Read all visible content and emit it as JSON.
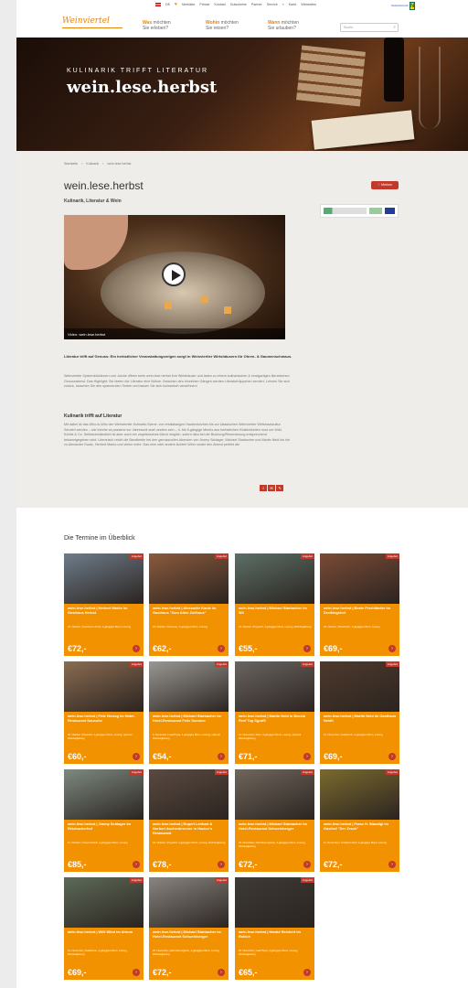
{
  "topbar": {
    "lang": "DE",
    "links": [
      "Merkliste",
      "Presse",
      "Kontakt",
      "Gutscheine",
      "Partner",
      "Service",
      "Karte",
      "Webseiten"
    ],
    "partner_logo": "Niederösterreich"
  },
  "nav": {
    "logo": "Weinviertel",
    "items": [
      {
        "hl": "Was",
        "rest": "möchten",
        "line2": "Sie erleben?"
      },
      {
        "hl": "Wohin",
        "rest": "möchten",
        "line2": "Sie reisen?"
      },
      {
        "hl": "Wann",
        "rest": "möchten",
        "line2": "Sie urlauben?"
      }
    ],
    "search_placeholder": "Suche"
  },
  "hero": {
    "kicker": "KULINARIK TRIFFT LITERATUR",
    "title": "wein.lese.herbst"
  },
  "breadcrumb": [
    "Startseite",
    "Kulinarik",
    "wein.lese.herbst"
  ],
  "page": {
    "title": "wein.lese.herbst",
    "subtitle": "Kulinarik, Literatur & Wein",
    "merken": "Merken",
    "video_caption": "Video: wein.lese.herbst",
    "lead": "Literatur trifft auf Genuss: Ein herbstlicher Veranstaltungsreigen sorgt in Weinviertler Wirtshäusern für Ohren- & Gaumenschmaus.",
    "para1": "Weinviertler Spitzenköchinnen und -köche öffnen beim wein.lese.herbst ihre Wirtshäuser und laden zu einem kulinarischen & einzigartigen literarischen Genussabend. Das Highlight: Sie bieten der Literatur eine Bühne. Zwischen den einzelnen Gängen werden Literaturhäppchen serviert. Lehnen Sie sich zurück, lauschen Sie den spannenden Texten und lassen Sie sich kulinarisch verwöhnen!",
    "h3": "Kulinarik trifft auf Literatur",
    "para2": "Mit dabei ist das Who-is-Who der Weinviertler Kulinarik-Szene, von erstklassigen Haubenköchen bis zur klassischen Weinviertler Wirtshauskultur. Serviert werden – wie könnte es passend zur Jahreszeit auch anders sein – 4- bis 5-gängige Menüs aus herbstlichen Köstlichkeiten rund um Wild, Kürbis & Co. Selbstverständlich ist aber auch ein vegetarisches Menü möglich, sofern dies bei der Buchung/Reservierung entsprechend bekanntgegeben wird. Literarisch reicht die Bandbreite bei den genussvollen Abenden von Jimmy Schlager, Michael Starbacher und Martin Neid bis hin zu Alexander Kautz, Herbert Marko und vielen mehr. Das eine oder andere Achterl Wein rundet den Abend perfekt ab!",
    "share": [
      "f",
      "✉",
      "✎"
    ]
  },
  "events": {
    "heading": "Die Termine im Überblick",
    "badge": "Angebot",
    "cards": [
      {
        "title": "wein.lese.herbst | Herbert Marko im Gasthaus Herbst",
        "meta": "22. Oktober | Gasthaus Herbst, 4-gängiges Menü, Lesung",
        "price": "€72,-",
        "photo": "#6e7c8a"
      },
      {
        "title": "wein.lese.herbst | Alexander Kautz im Gasthaus \"Zum Alten Zollhaus\"",
        "meta": "23. Oktober | Hohenau, 4-gängiges Menü, Lesung",
        "price": "€62,-",
        "photo": "#8b5a3c"
      },
      {
        "title": "wein.lese.herbst | Michael Starbacher im W4",
        "meta": "24. Oktober | Poysdorf, 4-gängiges Menü, Lesung, Weinbegleitung",
        "price": "€55,-",
        "photo": "#5c6f66"
      },
      {
        "title": "wein.lese.herbst | Beate Ferchländer im Drolkingshof",
        "meta": "29. Oktober | Mistelbach, 4-gängiges Menü, Lesung",
        "price": "€69,-",
        "photo": "#7a4b36"
      },
      {
        "title": "wein.lese.herbst | Fritz Herzog im Hotel-Restaurant Naussfer",
        "meta": "30. Oktober | Poysdorf, 4-gängiges Menü, Lesung, optional Weinbegleitung",
        "price": "€60,-",
        "photo": "#8a6c52"
      },
      {
        "title": "wein.lese.herbst | Michael Starbacher im Hotel-Restaurant Felix Sommer",
        "meta": "5. November | Laa/Thaya, 4-gängiges Menü, Lesung, optional Weinbegleitung",
        "price": "€54,-",
        "photo": "#9a9894"
      },
      {
        "title": "wein.lese.herbst | Martin Neid in Beccia Reef Top Sgraffi",
        "meta": "12. November | Retz, 4-gängiges Menü, Lesung, optional Weinbegleitung",
        "price": "€71,-",
        "photo": "#6a6460"
      },
      {
        "title": "wein.lese.herbst | Martin Neid im Gasthaus Neidh",
        "meta": "13. November | Hollabrunn, 4-gängiges Menü, Lesung",
        "price": "€69,-",
        "photo": "#4e3a2c"
      },
      {
        "title": "wein.lese.herbst | Jimmy Schlager im Retzbacherhof",
        "meta": "11. Oktober | Unterretzbach, 4-gängiges Menü, Lesung",
        "price": "€85,-",
        "photo": "#7d8a80"
      },
      {
        "title": "wein.lese.herbst | Rupert Lenhart & Norbert Aschenbrenner in Hacker's Restaurant",
        "meta": "18. Oktober | Poysdorf, 4-gängiges Menü, Lesung, Weinbegleitung",
        "price": "€78,-",
        "photo": "#5a4a40"
      },
      {
        "title": "wein.lese.herbst | Michael Starbacher im Hotel-Restaurant Schweinberger",
        "meta": "26. November | Herrnbaumgarten, 4-gängiges Menü, Lesung, Weinbegleitung",
        "price": "€72,-",
        "photo": "#6f665c"
      },
      {
        "title": "wein.lese.herbst | Franz H. Staudigl im Gasthof \"Der Zesch\"",
        "meta": "11. November | Großebersdorf, 4-gängiges Menü, Lesung",
        "price": "€72,-",
        "photo": "#7b6a2e"
      },
      {
        "title": "wein.lese.herbst | Willi Wind im Atrium",
        "meta": "12. November | Hollabrunn, 4-gängiges Menü, Lesung, Weinbegleitung",
        "price": "€69,-",
        "photo": "#5d6a58"
      },
      {
        "title": "wein.lese.herbst | Michael Starbacher im Hotel-Restaurant Schweinberger",
        "meta": "26. November | Herrnbaumgarten, 4-gängiges Menü, Lesung, Weinbegleitung",
        "price": "€72,-",
        "photo": "#8a8580"
      },
      {
        "title": "wein.lese.herbst | Harald Reichert im Rollich",
        "meta": "26. November | Laa/Thaya, 4-gängiges Menü, Lesung, Weinbegleitung",
        "price": "€65,-",
        "photo": "#3e3a36"
      }
    ]
  }
}
